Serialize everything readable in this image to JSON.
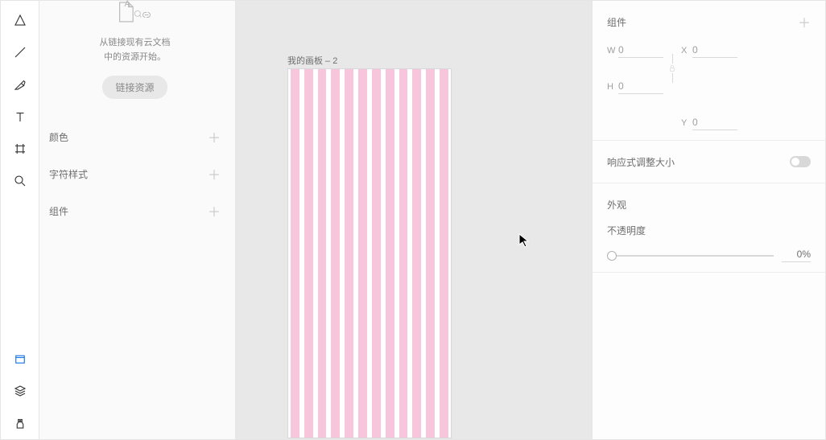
{
  "left_panel": {
    "hint_line1": "从链接现有云文档",
    "hint_line2": "中的资源开始。",
    "link_button": "链接资源",
    "sections": {
      "colors": "颜色",
      "char_styles": "字符样式",
      "components": "组件"
    }
  },
  "canvas": {
    "artboard_label": "我的画板 – 2"
  },
  "inspector": {
    "component_title": "组件",
    "transform": {
      "w_label": "W",
      "w_value": "0",
      "h_label": "H",
      "h_value": "0",
      "x_label": "X",
      "x_value": "0",
      "y_label": "Y",
      "y_value": "0"
    },
    "responsive_label": "响应式调整大小",
    "appearance_label": "外观",
    "opacity_label": "不透明度",
    "opacity_value": "0%"
  }
}
